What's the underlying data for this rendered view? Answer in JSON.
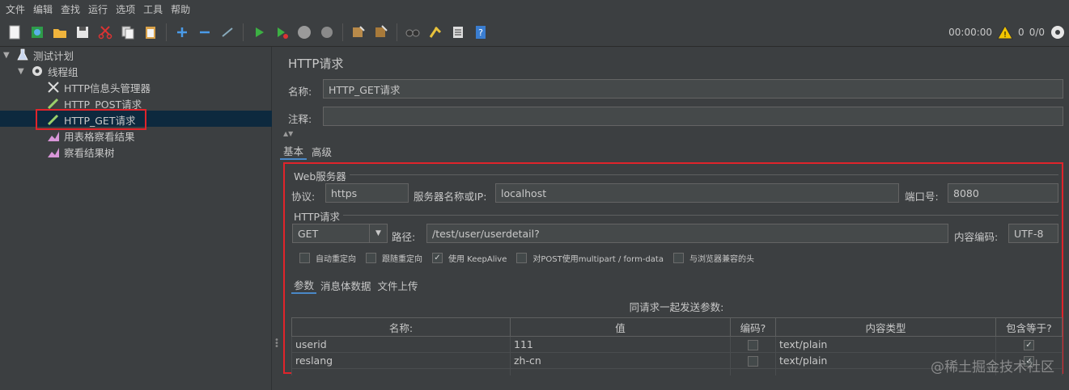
{
  "menu": [
    "文件",
    "编辑",
    "查找",
    "运行",
    "选项",
    "工具",
    "帮助"
  ],
  "toolbar_status": {
    "timer": "00:00:00",
    "warnings": "0",
    "threads": "0/0"
  },
  "tree": {
    "plan": "测试计划",
    "thread_group": "线程组",
    "items": [
      "HTTP信息头管理器",
      "HTTP_POST请求",
      "HTTP_GET请求",
      "用表格察看结果",
      "察看结果树"
    ]
  },
  "panel": {
    "title": "HTTP请求",
    "name_label": "名称:",
    "name_value": "HTTP_GET请求",
    "comment_label": "注释:",
    "comment_value": "",
    "tabs": [
      "基本",
      "高级"
    ],
    "web_server_label": "Web服务器",
    "protocol_label": "协议:",
    "protocol_value": "https",
    "server_label": "服务器名称或IP:",
    "server_value": "localhost",
    "port_label": "端口号:",
    "port_value": "8080",
    "http_request_label": "HTTP请求",
    "method_value": "GET",
    "path_label": "路径:",
    "path_value": "/test/user/userdetail?",
    "encoding_label": "内容编码:",
    "encoding_value": "UTF-8",
    "options": [
      {
        "label": "自动重定向",
        "checked": false
      },
      {
        "label": "跟随重定向",
        "checked": false
      },
      {
        "label": "使用 KeepAlive",
        "checked": true
      },
      {
        "label": "对POST使用multipart / form-data",
        "checked": false
      },
      {
        "label": "与浏览器兼容的头",
        "checked": false
      }
    ],
    "subtabs": [
      "参数",
      "消息体数据",
      "文件上传"
    ],
    "table_caption": "同请求一起发送参数:",
    "columns": [
      "名称:",
      "值",
      "编码?",
      "内容类型",
      "包含等于?"
    ],
    "rows": [
      {
        "name": "userid",
        "value": "111",
        "encode": false,
        "content_type": "text/plain",
        "include_equals": true
      },
      {
        "name": "reslang",
        "value": "zh-cn",
        "encode": false,
        "content_type": "text/plain",
        "include_equals": true
      }
    ]
  },
  "watermark": "@稀土掘金技术社区"
}
